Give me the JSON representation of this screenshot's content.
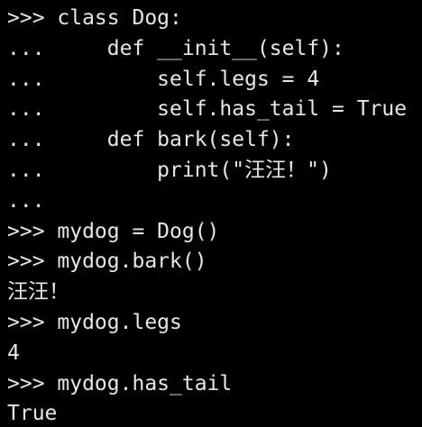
{
  "colors": {
    "background": "#000000",
    "foreground": "#e6e6e6"
  },
  "terminal": {
    "lines": [
      {
        "prompt": ">>> ",
        "code": "class Dog:"
      },
      {
        "prompt": "... ",
        "code": "    def __init__(self):"
      },
      {
        "prompt": "... ",
        "code": "        self.legs = 4"
      },
      {
        "prompt": "... ",
        "code": "        self.has_tail = True"
      },
      {
        "prompt": "... ",
        "code": "    def bark(self):"
      },
      {
        "prompt": "... ",
        "code": "        print(\"汪汪！\")"
      },
      {
        "prompt": "...",
        "code": ""
      },
      {
        "prompt": ">>> ",
        "code": "mydog = Dog()"
      },
      {
        "prompt": ">>> ",
        "code": "mydog.bark()"
      },
      {
        "output": "汪汪！"
      },
      {
        "prompt": ">>> ",
        "code": "mydog.legs"
      },
      {
        "output": "4"
      },
      {
        "prompt": ">>> ",
        "code": "mydog.has_tail"
      },
      {
        "output": "True"
      }
    ]
  }
}
